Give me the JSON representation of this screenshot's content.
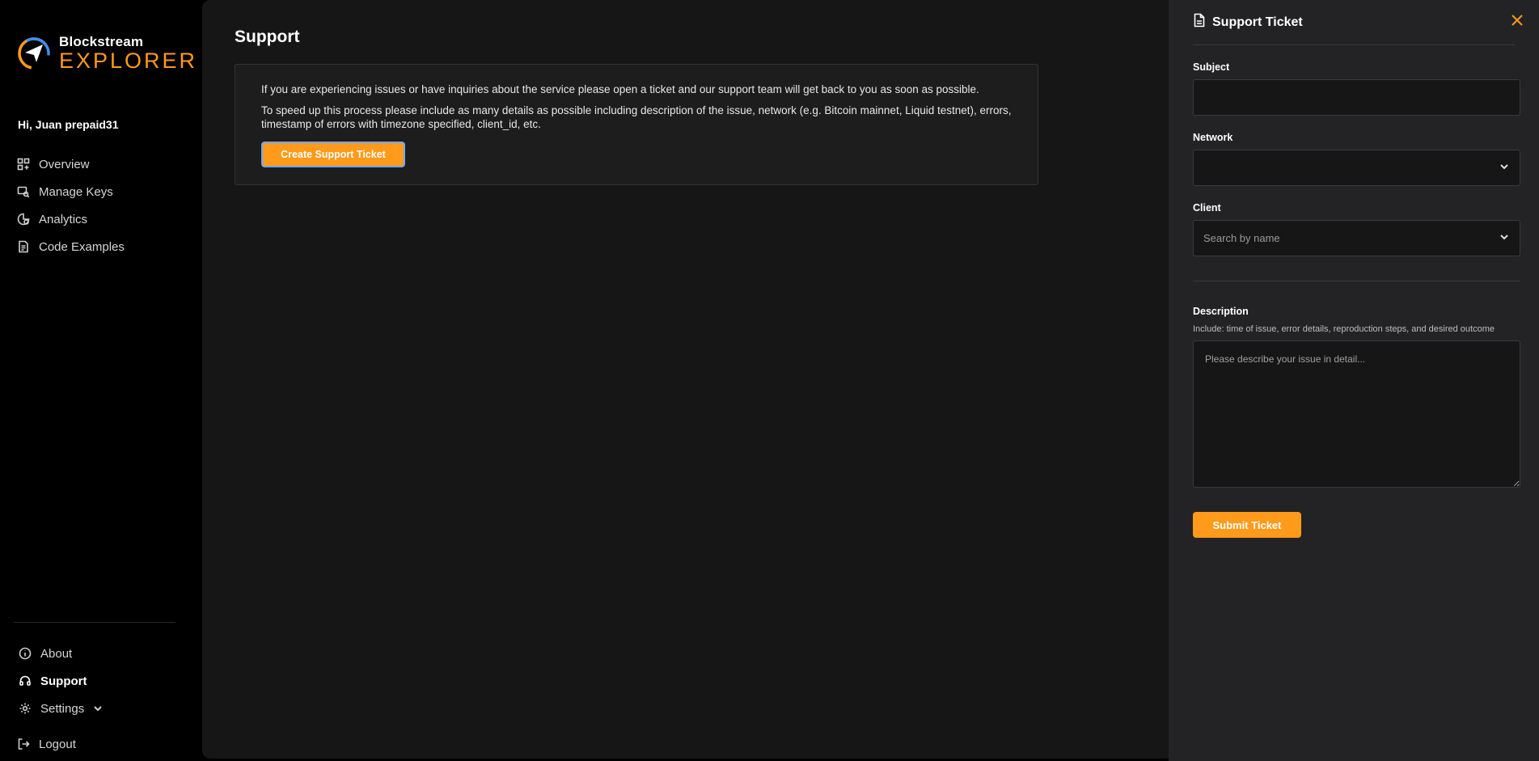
{
  "brand": {
    "name_top": "Blockstream",
    "name_bottom": "EXPLORER",
    "accent": "#ff9a1a"
  },
  "sidebar": {
    "greeting": "Hi, Juan prepaid31",
    "items": [
      {
        "label": "Overview",
        "icon": "grid-icon"
      },
      {
        "label": "Manage Keys",
        "icon": "key-icon"
      },
      {
        "label": "Analytics",
        "icon": "analytics-icon"
      },
      {
        "label": "Code Examples",
        "icon": "document-icon"
      }
    ],
    "bottom_items": [
      {
        "label": "About",
        "icon": "info-icon"
      },
      {
        "label": "Support",
        "icon": "headset-icon",
        "active": true
      },
      {
        "label": "Settings",
        "icon": "gear-icon"
      }
    ],
    "logout": "Logout"
  },
  "main": {
    "title": "Support",
    "paragraph_1": "If you are experiencing issues or have inquiries about the service please open a ticket and our support team will get back to you as soon as possible.",
    "paragraph_2": "To speed up this process please include as many details as possible including description of the issue, network (e.g. Bitcoin mainnet, Liquid testnet), errors, timestamp of errors with timezone specified, client_id, etc.",
    "create_button": "Create Support Ticket"
  },
  "panel": {
    "title": "Support Ticket",
    "subject_label": "Subject",
    "subject_value": "",
    "network_label": "Network",
    "network_value": "",
    "client_label": "Client",
    "client_placeholder": "Search by name",
    "description_label": "Description",
    "description_hint": "Include: time of issue, error details, reproduction steps, and desired outcome",
    "description_placeholder": "Please describe your issue in detail...",
    "submit_button": "Submit Ticket"
  }
}
